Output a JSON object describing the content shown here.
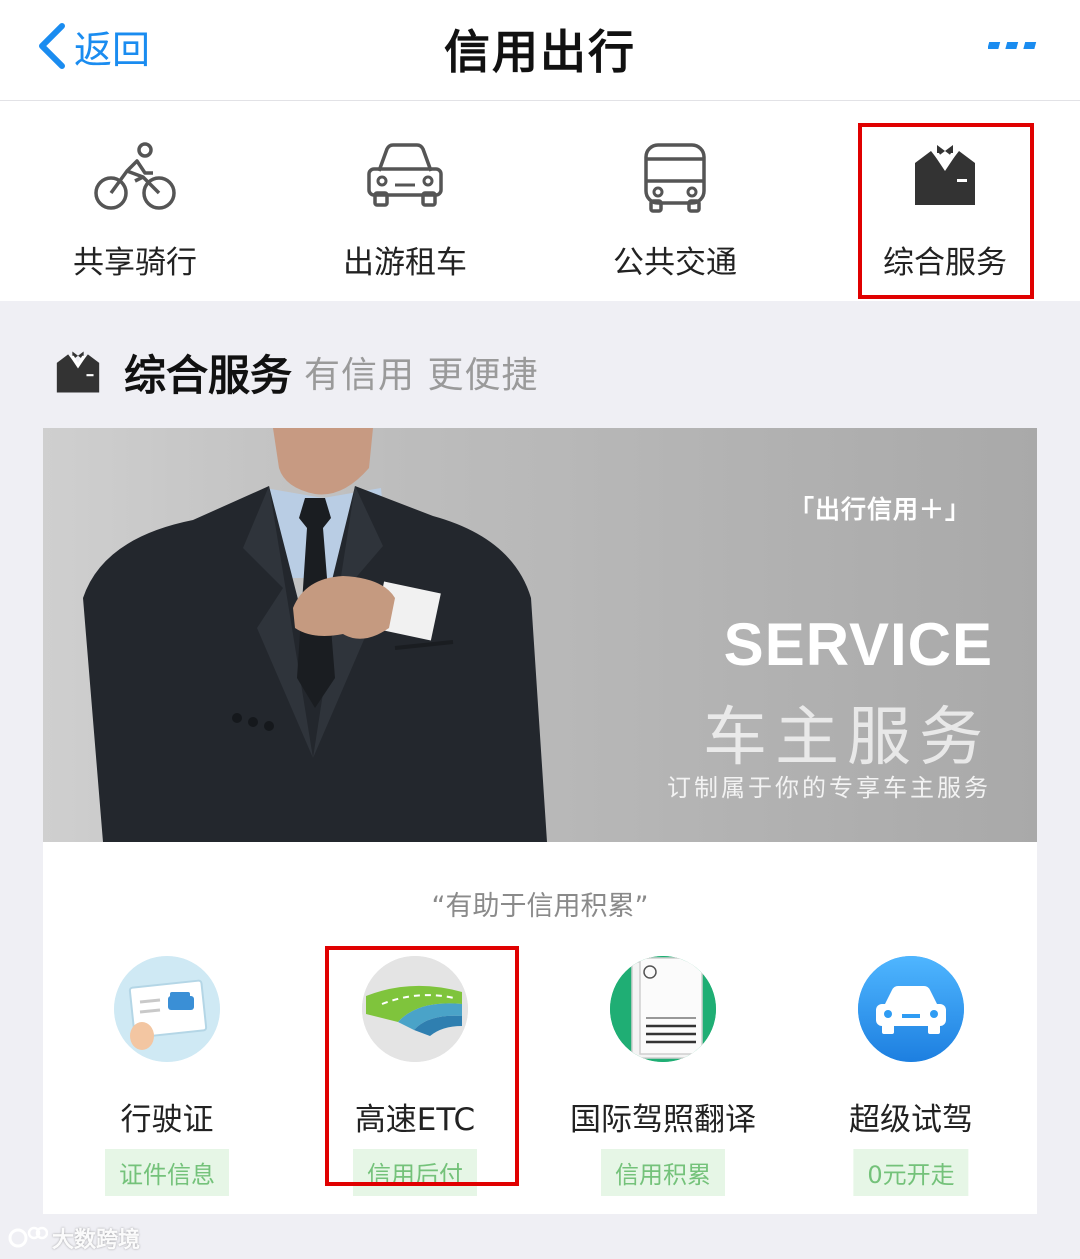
{
  "nav": {
    "back_label": "返回",
    "title": "信用出行",
    "more_icon": "more-dots-icon"
  },
  "categories": [
    {
      "label": "共享骑行",
      "icon": "bicycle-icon"
    },
    {
      "label": "出游租车",
      "icon": "car-icon"
    },
    {
      "label": "公共交通",
      "icon": "bus-icon"
    },
    {
      "label": "综合服务",
      "icon": "tuxedo-icon",
      "selected": true
    }
  ],
  "section": {
    "title": "综合服务",
    "subtitle": "有信用 更便捷"
  },
  "banner": {
    "tag": "「出行信用＋」",
    "service": "SERVICE",
    "title_cn": "车主服务",
    "desc": "订制属于你的专享车主服务"
  },
  "quote": "“有助于信用积累”",
  "services": [
    {
      "name": "行驶证",
      "tag": "证件信息",
      "icon": "vehicle-license-icon"
    },
    {
      "name": "高速ETC",
      "tag": "信用后付",
      "icon": "highway-road-icon",
      "highlighted": true
    },
    {
      "name": "国际驾照翻译",
      "tag": "信用积累",
      "icon": "driver-license-document-icon"
    },
    {
      "name": "超级试驾",
      "tag": "0元开走",
      "icon": "car-icon"
    }
  ],
  "watermark": "大数跨境",
  "colors": {
    "accent_blue": "#1a8cf0",
    "highlight_red": "#e00000",
    "tag_green_text": "#74c27a",
    "tag_green_bg": "#e6f6e6"
  }
}
